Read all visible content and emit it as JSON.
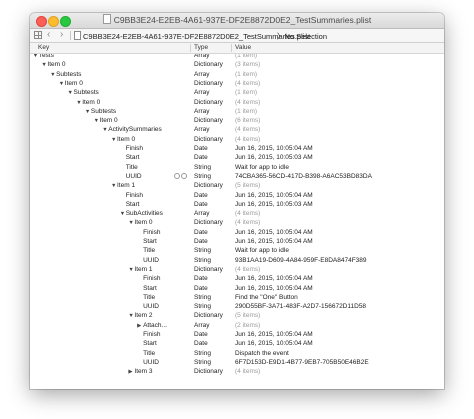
{
  "window": {
    "title": "C9BB3E24-E2EB-4A61-937E-DF2E8872D0E2_TestSummaries.plist"
  },
  "navbar": {
    "crumb_file": "C9BB3E24-E2EB-4A61-937E-DF2E8872D0E2_TestSummaries.plist",
    "crumb_selection": "No Selection"
  },
  "columns": {
    "key": "Key",
    "type": "Type",
    "value": "Value"
  },
  "rows": [
    {
      "key": "Tests",
      "type": "Array",
      "value": "(1 item)",
      "depth": 1,
      "disc": "open",
      "count": true
    },
    {
      "key": "Item 0",
      "type": "Dictionary",
      "value": "(3 items)",
      "depth": 2,
      "disc": "open",
      "count": true
    },
    {
      "key": "Subtests",
      "type": "Array",
      "value": "(1 item)",
      "depth": 3,
      "disc": "open",
      "count": true
    },
    {
      "key": "Item 0",
      "type": "Dictionary",
      "value": "(4 items)",
      "depth": 4,
      "disc": "open",
      "count": true
    },
    {
      "key": "Subtests",
      "type": "Array",
      "value": "(1 item)",
      "depth": 5,
      "disc": "open",
      "count": true
    },
    {
      "key": "Item 0",
      "type": "Dictionary",
      "value": "(4 items)",
      "depth": 6,
      "disc": "open",
      "count": true
    },
    {
      "key": "Subtests",
      "type": "Array",
      "value": "(1 item)",
      "depth": 7,
      "disc": "open",
      "count": true
    },
    {
      "key": "Item 0",
      "type": "Dictionary",
      "value": "(6 items)",
      "depth": 8,
      "disc": "open",
      "count": true
    },
    {
      "key": "ActivitySummaries",
      "type": "Array",
      "value": "(4 items)",
      "depth": 9,
      "disc": "open",
      "count": true
    },
    {
      "key": "Item 0",
      "type": "Dictionary",
      "value": "(4 items)",
      "depth": 10,
      "disc": "open",
      "count": true
    },
    {
      "key": "Finish",
      "type": "Date",
      "value": "Jun 16, 2015, 10:05:04 AM",
      "depth": 11,
      "disc": "none",
      "count": false
    },
    {
      "key": "Start",
      "type": "Date",
      "value": "Jun 16, 2015, 10:05:03 AM",
      "depth": 11,
      "disc": "none",
      "count": false
    },
    {
      "key": "Title",
      "type": "String",
      "value": "Wait for app to idle",
      "depth": 11,
      "disc": "none",
      "count": false
    },
    {
      "key": "UUID",
      "type": "String",
      "value": "74CBA365-56CD-417D-B398-A6AC53BD83DA",
      "depth": 11,
      "disc": "none",
      "count": false,
      "stepper": true
    },
    {
      "key": "Item 1",
      "type": "Dictionary",
      "value": "(5 items)",
      "depth": 10,
      "disc": "open",
      "count": true
    },
    {
      "key": "Finish",
      "type": "Date",
      "value": "Jun 16, 2015, 10:05:04 AM",
      "depth": 11,
      "disc": "none",
      "count": false
    },
    {
      "key": "Start",
      "type": "Date",
      "value": "Jun 16, 2015, 10:05:03 AM",
      "depth": 11,
      "disc": "none",
      "count": false
    },
    {
      "key": "SubActivities",
      "type": "Array",
      "value": "(4 items)",
      "depth": 11,
      "disc": "open",
      "count": true
    },
    {
      "key": "Item 0",
      "type": "Dictionary",
      "value": "(4 items)",
      "depth": 12,
      "disc": "open",
      "count": true
    },
    {
      "key": "Finish",
      "type": "Date",
      "value": "Jun 16, 2015, 10:05:04 AM",
      "depth": 13,
      "disc": "none",
      "count": false
    },
    {
      "key": "Start",
      "type": "Date",
      "value": "Jun 16, 2015, 10:05:04 AM",
      "depth": 13,
      "disc": "none",
      "count": false
    },
    {
      "key": "Title",
      "type": "String",
      "value": "Wait for app to idle",
      "depth": 13,
      "disc": "none",
      "count": false
    },
    {
      "key": "UUID",
      "type": "String",
      "value": "93B1AA19-D609-4A84-959F-E8DA8474F389",
      "depth": 13,
      "disc": "none",
      "count": false
    },
    {
      "key": "Item 1",
      "type": "Dictionary",
      "value": "(4 items)",
      "depth": 12,
      "disc": "open",
      "count": true
    },
    {
      "key": "Finish",
      "type": "Date",
      "value": "Jun 16, 2015, 10:05:04 AM",
      "depth": 13,
      "disc": "none",
      "count": false
    },
    {
      "key": "Start",
      "type": "Date",
      "value": "Jun 16, 2015, 10:05:04 AM",
      "depth": 13,
      "disc": "none",
      "count": false
    },
    {
      "key": "Title",
      "type": "String",
      "value": "Find the \"One\" Button",
      "depth": 13,
      "disc": "none",
      "count": false
    },
    {
      "key": "UUID",
      "type": "String",
      "value": "290D55BF-3A71-483F-A2D7-156672D11D58",
      "depth": 13,
      "disc": "none",
      "count": false
    },
    {
      "key": "Item 2",
      "type": "Dictionary",
      "value": "(5 items)",
      "depth": 12,
      "disc": "open",
      "count": true
    },
    {
      "key": "Attach...",
      "type": "Array",
      "value": "(2 items)",
      "depth": 13,
      "disc": "closed",
      "count": true
    },
    {
      "key": "Finish",
      "type": "Date",
      "value": "Jun 16, 2015, 10:05:04 AM",
      "depth": 13,
      "disc": "none",
      "count": false
    },
    {
      "key": "Start",
      "type": "Date",
      "value": "Jun 16, 2015, 10:05:04 AM",
      "depth": 13,
      "disc": "none",
      "count": false
    },
    {
      "key": "Title",
      "type": "String",
      "value": "Dispatch the event",
      "depth": 13,
      "disc": "none",
      "count": false
    },
    {
      "key": "UUID",
      "type": "String",
      "value": "6F7D153D-E9D1-4B77-9EB7-705B50E46B2E",
      "depth": 13,
      "disc": "none",
      "count": false
    },
    {
      "key": "Item 3",
      "type": "Dictionary",
      "value": "(4 items)",
      "depth": 12,
      "disc": "closed",
      "count": true
    }
  ]
}
